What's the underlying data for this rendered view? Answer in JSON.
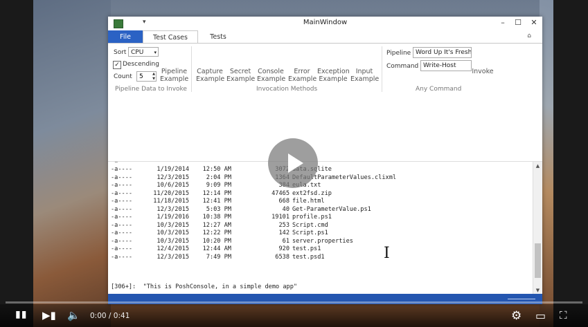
{
  "window": {
    "title": "MainWindow"
  },
  "ribbon_tabs": [
    {
      "label": "File"
    },
    {
      "label": "Test Cases"
    },
    {
      "label": "Tests"
    }
  ],
  "pipeline_group": {
    "sort_label": "Sort",
    "sort_value": "CPU",
    "descending_label": "Descending",
    "descending_checked": "✓",
    "count_label": "Count",
    "count_value": "5",
    "example_line1": "Pipeline",
    "example_line2": "Example",
    "group_label": "Pipeline Data to Invoke"
  },
  "invocation_group": {
    "buttons": [
      {
        "line1": "Capture",
        "line2": "Example"
      },
      {
        "line1": "Secret",
        "line2": "Example"
      },
      {
        "line1": "Console",
        "line2": "Example"
      },
      {
        "line1": "Error",
        "line2": "Example"
      },
      {
        "line1": "Exception",
        "line2": "Example"
      },
      {
        "line1": "Input",
        "line2": "Example"
      }
    ],
    "group_label": "Invocation Methods"
  },
  "any_command_group": {
    "pipeline_label": "Pipeline",
    "pipeline_value": "Word Up It's Fresh",
    "command_label": "Command",
    "command_value": "Write-Host",
    "invoke_label": "Invoke",
    "group_label": "Any Command"
  },
  "console": {
    "rows": [
      {
        "mode": "-a----",
        "date": "1/19/2014",
        "time": "12:50 AM",
        "size": "3072",
        "name": "data.sqlite"
      },
      {
        "mode": "-a----",
        "date": "12/3/2015",
        "time": "2:04 PM",
        "size": "1364",
        "name": "DefaultParameterValues.clixml"
      },
      {
        "mode": "-a----",
        "date": "10/6/2015",
        "time": "9:09 PM",
        "size": "384",
        "name": "eula.txt"
      },
      {
        "mode": "-a----",
        "date": "11/20/2015",
        "time": "12:14 PM",
        "size": "47465",
        "name": "ext2fsd.zip"
      },
      {
        "mode": "-a----",
        "date": "11/18/2015",
        "time": "12:41 PM",
        "size": "668",
        "name": "file.html"
      },
      {
        "mode": "-a----",
        "date": "12/3/2015",
        "time": "5:03 PM",
        "size": "40",
        "name": "Get-ParameterValue.ps1"
      },
      {
        "mode": "-a----",
        "date": "1/19/2016",
        "time": "10:38 PM",
        "size": "19101",
        "name": "profile.ps1"
      },
      {
        "mode": "-a----",
        "date": "10/3/2015",
        "time": "12:27 AM",
        "size": "253",
        "name": "Script.cmd"
      },
      {
        "mode": "-a----",
        "date": "10/3/2015",
        "time": "12:22 PM",
        "size": "142",
        "name": "Script.ps1"
      },
      {
        "mode": "-a----",
        "date": "10/3/2015",
        "time": "10:20 PM",
        "size": "61",
        "name": "server.properties"
      },
      {
        "mode": "-a----",
        "date": "12/4/2015",
        "time": "12:44 AM",
        "size": "920",
        "name": "test.ps1"
      },
      {
        "mode": "-a----",
        "date": "12/3/2015",
        "time": "7:49 PM",
        "size": "6538",
        "name": "test.psd1"
      }
    ],
    "prompt": "[306+]:  \"This is PoshConsole, in a simple demo app\""
  },
  "player": {
    "time": "0:00 / 0:41",
    "progress": 0
  }
}
